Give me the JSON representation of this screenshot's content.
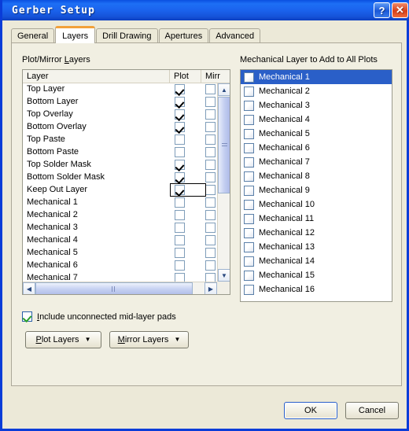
{
  "window": {
    "title": "Gerber Setup",
    "help_button": "?",
    "close_button": "✕"
  },
  "tabs": [
    {
      "label": "General",
      "active": false
    },
    {
      "label": "Layers",
      "active": true
    },
    {
      "label": "Drill Drawing",
      "active": false
    },
    {
      "label": "Apertures",
      "active": false
    },
    {
      "label": "Advanced",
      "active": false
    }
  ],
  "left_panel": {
    "group_label_pre": "Plot/Mirror ",
    "group_label_accel": "L",
    "group_label_post": "ayers",
    "columns": [
      "Layer",
      "Plot",
      "Mirr"
    ],
    "rows": [
      {
        "layer": "Top Layer",
        "plot": true,
        "mirror": false,
        "focused": false
      },
      {
        "layer": "Bottom Layer",
        "plot": true,
        "mirror": false,
        "focused": false
      },
      {
        "layer": "Top Overlay",
        "plot": true,
        "mirror": false,
        "focused": false
      },
      {
        "layer": "Bottom Overlay",
        "plot": true,
        "mirror": false,
        "focused": false
      },
      {
        "layer": "Top Paste",
        "plot": false,
        "mirror": false,
        "focused": false
      },
      {
        "layer": "Bottom Paste",
        "plot": false,
        "mirror": false,
        "focused": false
      },
      {
        "layer": "Top Solder Mask",
        "plot": true,
        "mirror": false,
        "focused": false
      },
      {
        "layer": "Bottom Solder Mask",
        "plot": true,
        "mirror": false,
        "focused": false
      },
      {
        "layer": "Keep Out Layer",
        "plot": true,
        "mirror": false,
        "focused": true
      },
      {
        "layer": "Mechanical 1",
        "plot": false,
        "mirror": false,
        "focused": false
      },
      {
        "layer": "Mechanical 2",
        "plot": false,
        "mirror": false,
        "focused": false
      },
      {
        "layer": "Mechanical 3",
        "plot": false,
        "mirror": false,
        "focused": false
      },
      {
        "layer": "Mechanical 4",
        "plot": false,
        "mirror": false,
        "focused": false
      },
      {
        "layer": "Mechanical 5",
        "plot": false,
        "mirror": false,
        "focused": false
      },
      {
        "layer": "Mechanical 6",
        "plot": false,
        "mirror": false,
        "focused": false
      },
      {
        "layer": "Mechanical 7",
        "plot": false,
        "mirror": false,
        "focused": false
      }
    ]
  },
  "right_panel": {
    "group_label": "Mechanical Layer to Add to All Plots",
    "rows": [
      {
        "label": "Mechanical 1",
        "checked": false,
        "selected": true
      },
      {
        "label": "Mechanical 2",
        "checked": false,
        "selected": false
      },
      {
        "label": "Mechanical 3",
        "checked": false,
        "selected": false
      },
      {
        "label": "Mechanical 4",
        "checked": false,
        "selected": false
      },
      {
        "label": "Mechanical 5",
        "checked": false,
        "selected": false
      },
      {
        "label": "Mechanical 6",
        "checked": false,
        "selected": false
      },
      {
        "label": "Mechanical 7",
        "checked": false,
        "selected": false
      },
      {
        "label": "Mechanical 8",
        "checked": false,
        "selected": false
      },
      {
        "label": "Mechanical 9",
        "checked": false,
        "selected": false
      },
      {
        "label": "Mechanical 10",
        "checked": false,
        "selected": false
      },
      {
        "label": "Mechanical 11",
        "checked": false,
        "selected": false
      },
      {
        "label": "Mechanical 12",
        "checked": false,
        "selected": false
      },
      {
        "label": "Mechanical 13",
        "checked": false,
        "selected": false
      },
      {
        "label": "Mechanical 14",
        "checked": false,
        "selected": false
      },
      {
        "label": "Mechanical 15",
        "checked": false,
        "selected": false
      },
      {
        "label": "Mechanical 16",
        "checked": false,
        "selected": false
      }
    ]
  },
  "options": {
    "include_pads_checked": true,
    "include_pads_pre": "",
    "include_pads_accel": "I",
    "include_pads_post": "nclude unconnected mid-layer pads"
  },
  "buttons": {
    "plot_layers_pre": "",
    "plot_layers_accel": "P",
    "plot_layers_post": "lot Layers",
    "mirror_layers_pre": "",
    "mirror_layers_accel": "M",
    "mirror_layers_post": "irror Layers",
    "caret": "▼",
    "ok": "OK",
    "cancel": "Cancel"
  },
  "colors": {
    "titlebar_blue": "#1b64ee",
    "dialog_face": "#ece9d8",
    "panel_face": "#f1efe2",
    "selection_blue": "#2a5fc8",
    "active_tab_accent": "#f2a13a",
    "check_green": "#2aa02a"
  }
}
